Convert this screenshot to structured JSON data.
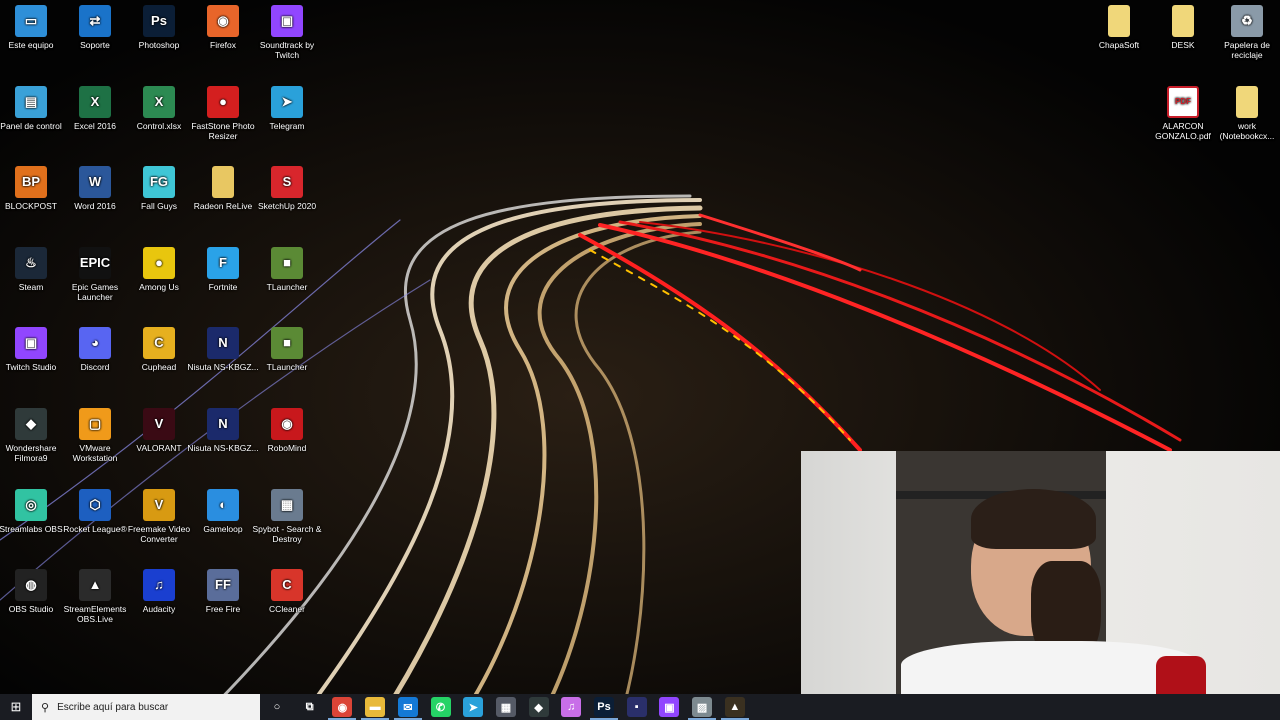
{
  "desktop": {
    "left_icons": [
      {
        "label": "Este equipo",
        "color": "#2e8fd8",
        "glyph": "▭"
      },
      {
        "label": "Soporte",
        "color": "#1a73c9",
        "glyph": "⇄"
      },
      {
        "label": "Photoshop",
        "color": "#0b1e36",
        "glyph": "Ps"
      },
      {
        "label": "Firefox",
        "color": "#e8652a",
        "glyph": "◉"
      },
      {
        "label": "Soundtrack by Twitch",
        "color": "#9146ff",
        "glyph": "▣"
      },
      {
        "label": "Panel de control",
        "color": "#3aa1d8",
        "glyph": "▤"
      },
      {
        "label": "Excel 2016",
        "color": "#1e7145",
        "glyph": "X"
      },
      {
        "label": "Control.xlsx",
        "color": "#2c8a52",
        "glyph": "X"
      },
      {
        "label": "FastStone Photo Resizer",
        "color": "#d41f1f",
        "glyph": "●"
      },
      {
        "label": "Telegram",
        "color": "#2aa1da",
        "glyph": "➤"
      },
      {
        "label": "BLOCKPOST",
        "color": "#e0701c",
        "glyph": "BP"
      },
      {
        "label": "Word 2016",
        "color": "#2b579a",
        "glyph": "W"
      },
      {
        "label": "Fall Guys",
        "color": "#3fc6d6",
        "glyph": "FG"
      },
      {
        "label": "Radeon ReLive",
        "color": "#e8c762",
        "glyph": ""
      },
      {
        "label": "SketchUp 2020",
        "color": "#d8262c",
        "glyph": "S"
      },
      {
        "label": "Steam",
        "color": "#1b2838",
        "glyph": "♨"
      },
      {
        "label": "Epic Games Launcher",
        "color": "#111111",
        "glyph": "EPIC"
      },
      {
        "label": "Among Us",
        "color": "#e8c60e",
        "glyph": "●"
      },
      {
        "label": "Fortnite",
        "color": "#2aa2e8",
        "glyph": "F"
      },
      {
        "label": "TLauncher",
        "color": "#5b8a35",
        "glyph": "■"
      },
      {
        "label": "Twitch Studio",
        "color": "#9146ff",
        "glyph": "▣"
      },
      {
        "label": "Discord",
        "color": "#5865f2",
        "glyph": "◕"
      },
      {
        "label": "Cuphead",
        "color": "#e6b01f",
        "glyph": "C"
      },
      {
        "label": "Nisuta NS-KBGZ...",
        "color": "#1b2a6b",
        "glyph": "N"
      },
      {
        "label": "TLauncher",
        "color": "#5b8a35",
        "glyph": "■"
      },
      {
        "label": "Wondershare Filmora9",
        "color": "#2f3a3a",
        "glyph": "◆"
      },
      {
        "label": "VMware Workstation",
        "color": "#f09a1a",
        "glyph": "▢"
      },
      {
        "label": "VALORANT",
        "color": "#3a0a14",
        "glyph": "V"
      },
      {
        "label": "Nisuta NS-KBGZ...",
        "color": "#1b2a6b",
        "glyph": "N"
      },
      {
        "label": "RoboMind",
        "color": "#c8181c",
        "glyph": "◉"
      },
      {
        "label": "Streamlabs OBS",
        "color": "#31c3a2",
        "glyph": "◎"
      },
      {
        "label": "Rocket League®",
        "color": "#1d5fc0",
        "glyph": "⬡"
      },
      {
        "label": "Freemake Video Converter",
        "color": "#d89a12",
        "glyph": "V"
      },
      {
        "label": "Gameloop",
        "color": "#2a8ee0",
        "glyph": "◐"
      },
      {
        "label": "Spybot - Search & Destroy",
        "color": "#6a7b8f",
        "glyph": "▦"
      },
      {
        "label": "OBS Studio",
        "color": "#222222",
        "glyph": "◍"
      },
      {
        "label": "StreamElements OBS.Live",
        "color": "#2b2b2b",
        "glyph": "▲"
      },
      {
        "label": "Audacity",
        "color": "#1a3fd0",
        "glyph": "♫"
      },
      {
        "label": "Free Fire",
        "color": "#5a6d9a",
        "glyph": "FF"
      },
      {
        "label": "CCleaner",
        "color": "#d8352a",
        "glyph": "C"
      }
    ],
    "right_icons": [
      {
        "label": "ChapaSoft",
        "color": "#f0d77a",
        "glyph": ""
      },
      {
        "label": "DESK",
        "color": "#f0d77a",
        "glyph": ""
      },
      {
        "label": "Papelera de reciclaje",
        "color": "#8a9aa8",
        "glyph": "♻"
      },
      {
        "label": "ALARCON GONZALO.pdf",
        "color": "#ffffff",
        "glyph": "PDF"
      },
      {
        "label": "work (Notebookcx...",
        "color": "#f0d77a",
        "glyph": ""
      }
    ]
  },
  "taskbar": {
    "search_placeholder": "Escribe aquí para buscar",
    "apps": [
      {
        "name": "cortana",
        "glyph": "○",
        "color": "transparent"
      },
      {
        "name": "task-view",
        "glyph": "⧉",
        "color": "transparent"
      },
      {
        "name": "chrome",
        "glyph": "◉",
        "color": "#db4437"
      },
      {
        "name": "file-explorer",
        "glyph": "▬",
        "color": "#e8b93a"
      },
      {
        "name": "mail",
        "glyph": "✉",
        "color": "#1479d6"
      },
      {
        "name": "whatsapp",
        "glyph": "✆",
        "color": "#25d366"
      },
      {
        "name": "telegram",
        "glyph": "➤",
        "color": "#2aa1da"
      },
      {
        "name": "calculator",
        "glyph": "▦",
        "color": "#555a66"
      },
      {
        "name": "filmora",
        "glyph": "◆",
        "color": "#2f3a3a"
      },
      {
        "name": "itunes",
        "glyph": "♫",
        "color": "#c86ee8"
      },
      {
        "name": "photoshop",
        "glyph": "Ps",
        "color": "#0b1e36"
      },
      {
        "name": "app-red",
        "glyph": "▪",
        "color": "#2a2f6a"
      },
      {
        "name": "twitch",
        "glyph": "▣",
        "color": "#9146ff"
      },
      {
        "name": "notebook",
        "glyph": "▨",
        "color": "#7d8a90"
      },
      {
        "name": "streamelements",
        "glyph": "▲",
        "color": "#3a3020"
      }
    ]
  }
}
